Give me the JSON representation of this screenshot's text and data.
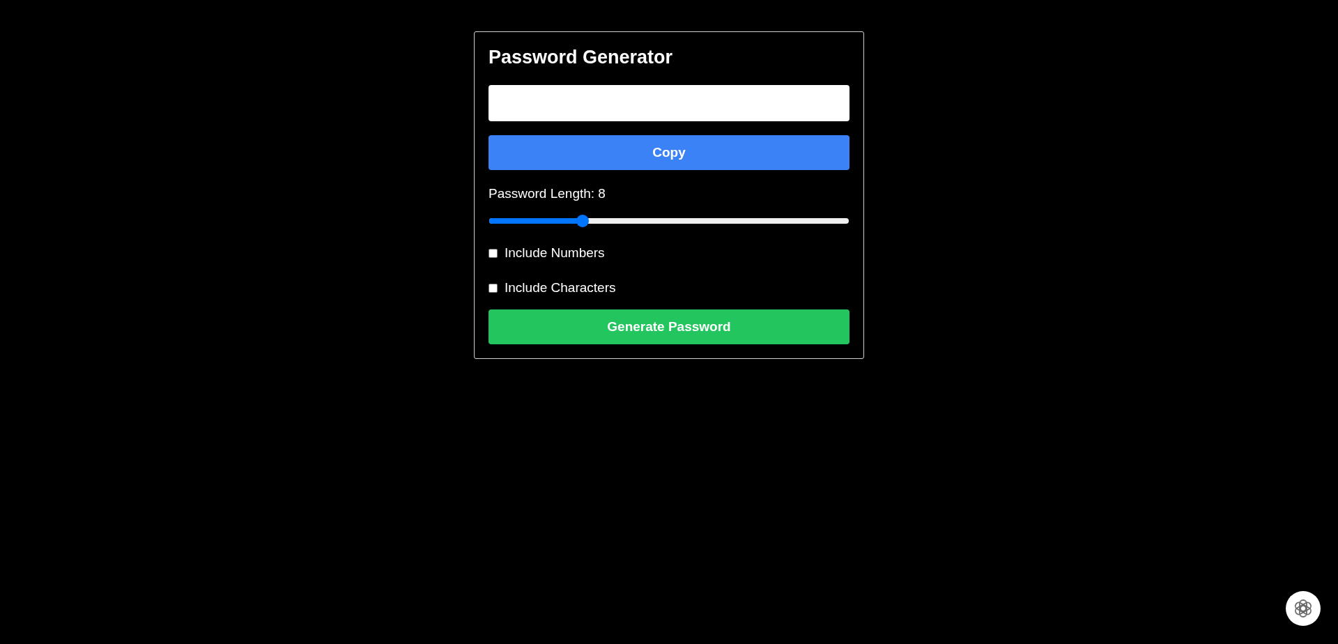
{
  "title": "Password Generator",
  "copy_button": "Copy",
  "length": {
    "label": "Password Length: 8",
    "level": 0.26
  },
  "options": [
    {
      "label": "Include Numbers",
      "checked": false
    },
    {
      "label": "Include Characters",
      "checked": false
    }
  ],
  "generate_button": "Generate Password"
}
